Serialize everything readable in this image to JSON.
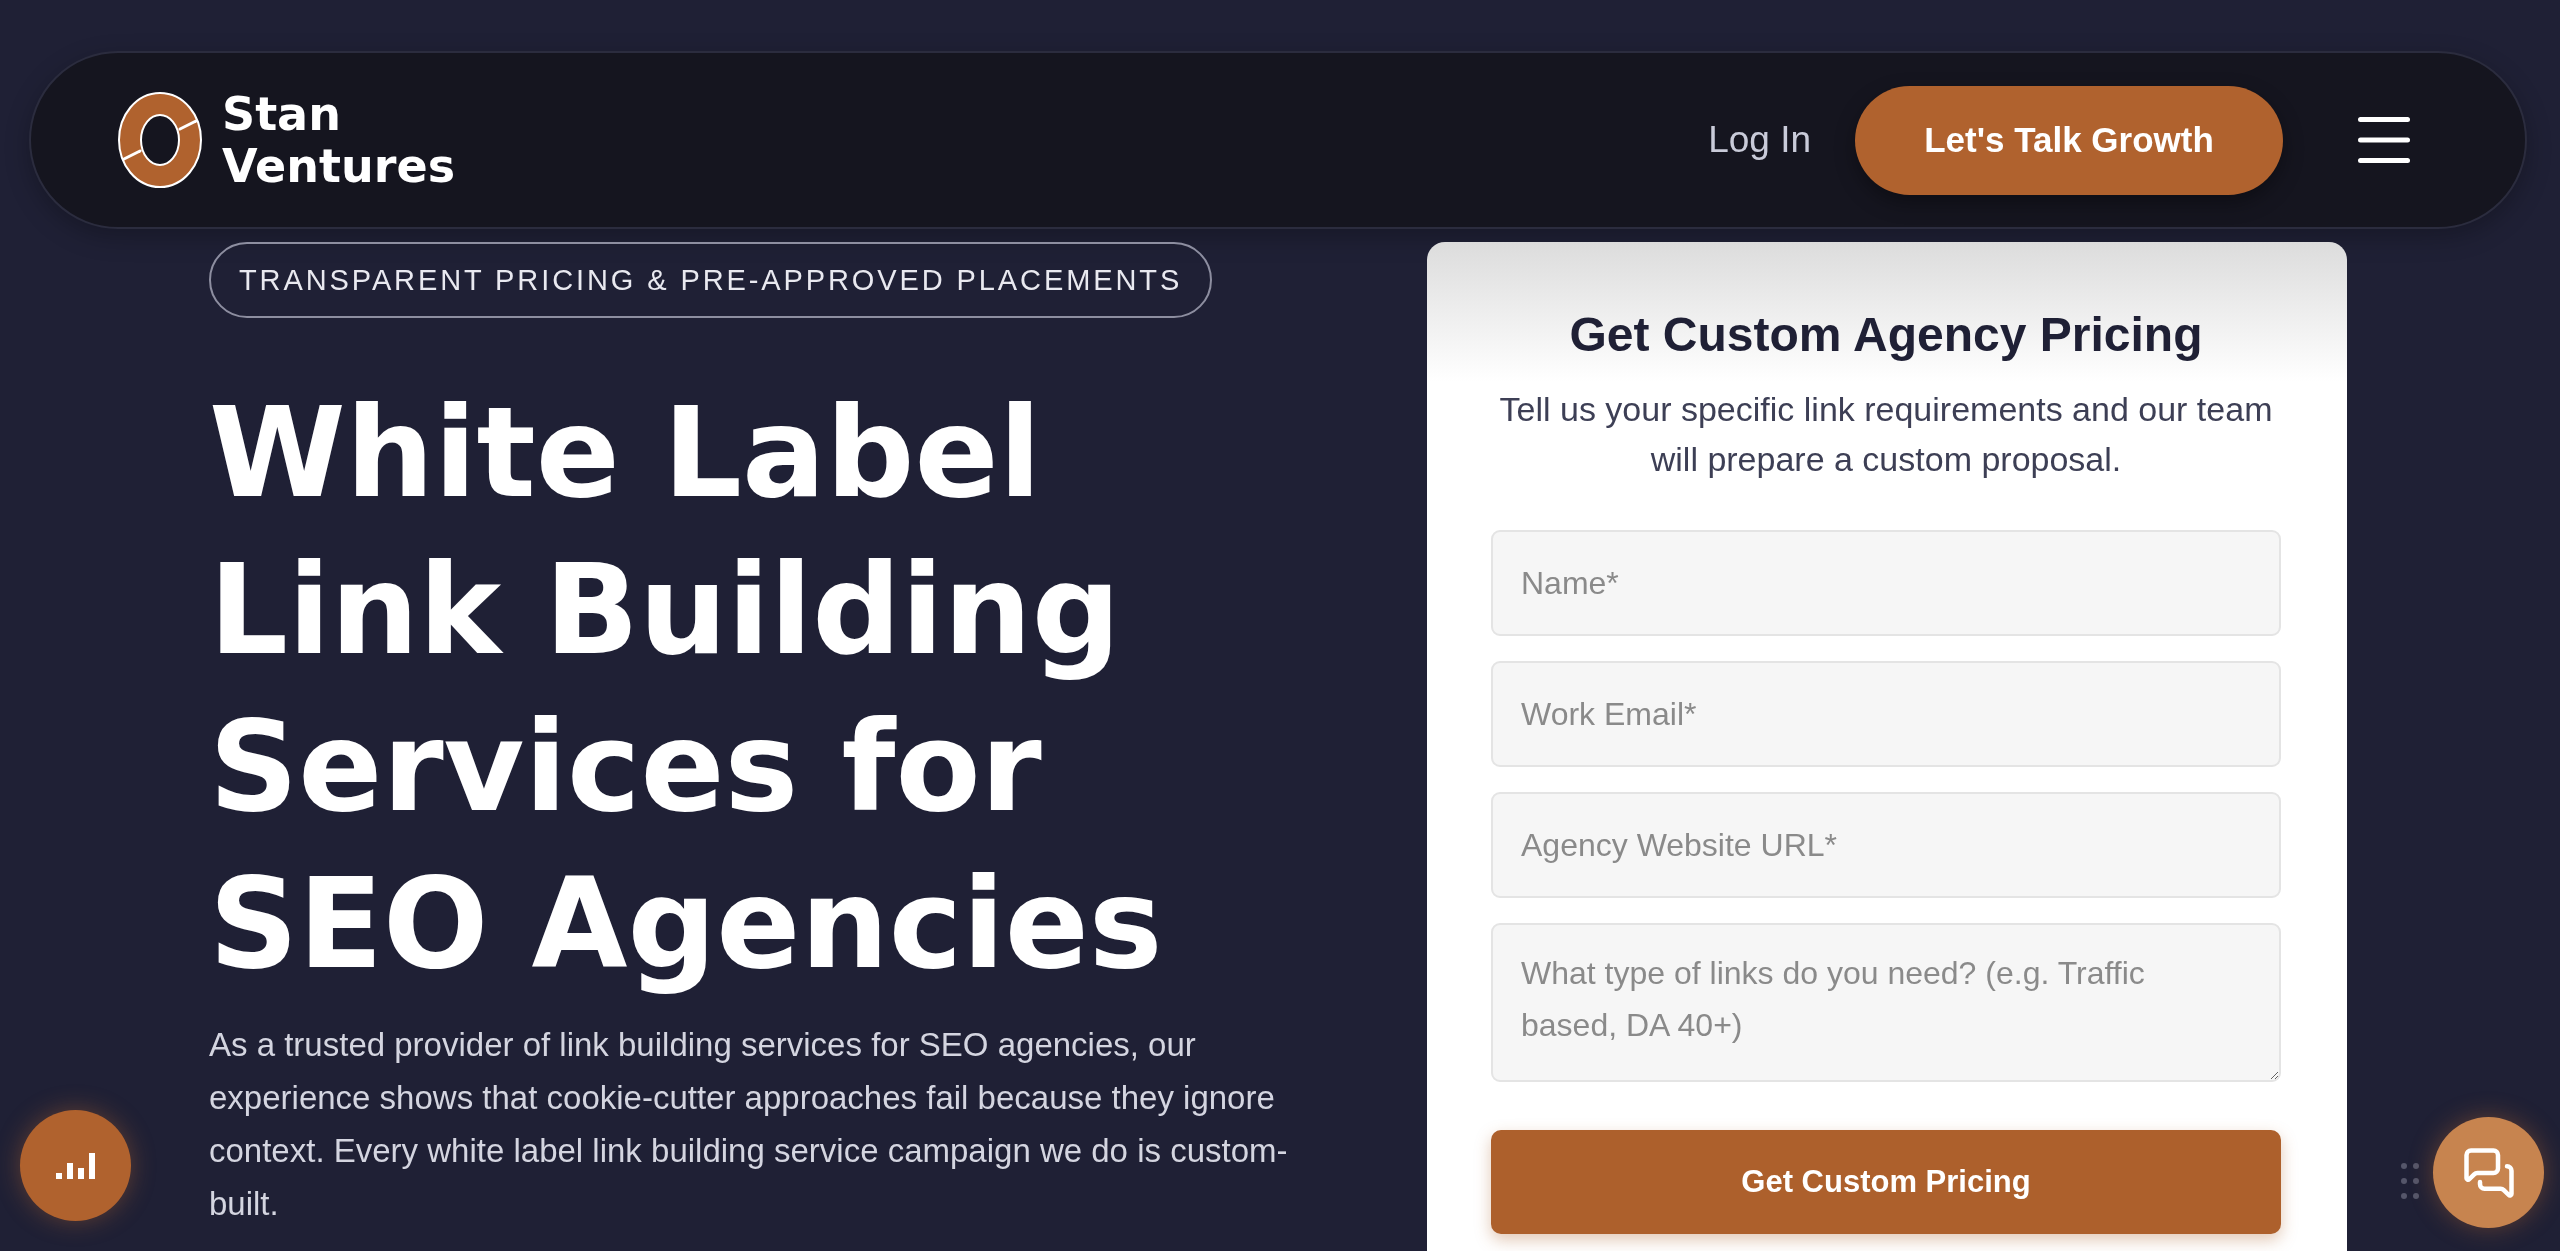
{
  "header": {
    "logo_text": "Stan Ventures",
    "login_link": "Log In",
    "cta_button": "Let's Talk Growth"
  },
  "hero": {
    "badge": "TRANSPARENT PRICING & PRE-APPROVED PLACEMENTS",
    "title": "White Label Link Building Services for SEO Agencies",
    "intro": "As a trusted provider of link building services for SEO agencies, our experience shows that cookie-cutter approaches fail because they ignore context. Every white label link building service campaign we do is custom-built."
  },
  "pricing_form": {
    "title": "Get Custom Agency Pricing",
    "subtitle": "Tell us your specific link requirements and our team will prepare a custom proposal.",
    "fields": [
      {
        "kind": "input",
        "placeholder": "Name*"
      },
      {
        "kind": "input",
        "placeholder": "Work Email*"
      },
      {
        "kind": "input",
        "placeholder": "Agency Website URL*"
      },
      {
        "kind": "textarea",
        "placeholder": "What type of links do you need? (e.g. Traffic based, DA 40+)"
      }
    ],
    "submit_button": "Get Custom Pricing"
  }
}
